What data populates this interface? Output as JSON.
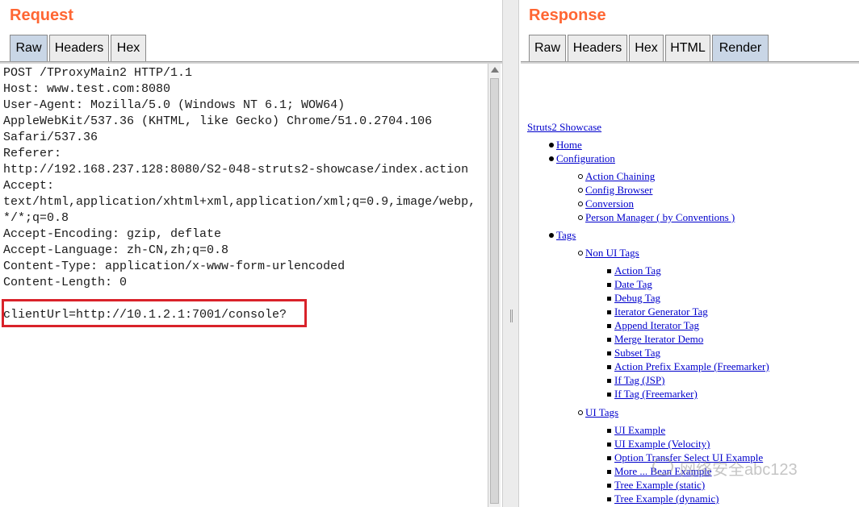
{
  "request": {
    "title": "Request",
    "tabs": [
      {
        "label": "Raw",
        "active": true
      },
      {
        "label": "Headers",
        "active": false
      },
      {
        "label": "Hex",
        "active": false
      }
    ],
    "lines": [
      "POST /TProxyMain2 HTTP/1.1",
      "Host: www.test.com:8080",
      "User-Agent: Mozilla/5.0 (Windows NT 6.1; WOW64)",
      "AppleWebKit/537.36 (KHTML, like Gecko) Chrome/51.0.2704.106",
      "Safari/537.36",
      "Referer:",
      "http://192.168.237.128:8080/S2-048-struts2-showcase/index.action",
      "Accept:",
      "text/html,application/xhtml+xml,application/xml;q=0.9,image/webp,",
      "*/*;q=0.8",
      "Accept-Encoding: gzip, deflate",
      "Accept-Language: zh-CN,zh;q=0.8",
      "Content-Type: application/x-www-form-urlencoded",
      "Content-Length: 0",
      "",
      "clientUrl=http://10.1.2.1:7001/console?"
    ]
  },
  "response": {
    "title": "Response",
    "tabs": [
      {
        "label": "Raw",
        "active": false
      },
      {
        "label": "Headers",
        "active": false
      },
      {
        "label": "Hex",
        "active": false
      },
      {
        "label": "HTML",
        "active": false
      },
      {
        "label": "Render",
        "active": true
      }
    ],
    "render": {
      "root": "Struts2 Showcase",
      "home": "Home",
      "configuration": "Configuration",
      "config_items": [
        "Action Chaining",
        "Config Browser",
        "Conversion",
        "Person Manager ( by Conventions )"
      ],
      "tags": "Tags",
      "non_ui_tags": "Non UI Tags",
      "non_ui_items": [
        "Action Tag",
        "Date Tag",
        "Debug Tag",
        "Iterator Generator Tag",
        "Append Iterator Tag",
        "Merge Iterator Demo",
        "Subset Tag",
        "Action Prefix Example (Freemarker)",
        "If Tag (JSP)",
        "If Tag (Freemarker)"
      ],
      "ui_tags": "UI Tags",
      "ui_items": [
        "UI Example",
        "UI Example (Velocity)",
        "Option Transfer Select UI Example",
        "More ... Bean Example",
        "Tree Example (static)",
        "Tree Example (dynamic)"
      ]
    }
  },
  "watermark": "网络安全abc123",
  "colors": {
    "title": "#ff6633",
    "link": "#0000cc",
    "highlight": "#d9222a",
    "active_tab": "#c9d6e6"
  }
}
